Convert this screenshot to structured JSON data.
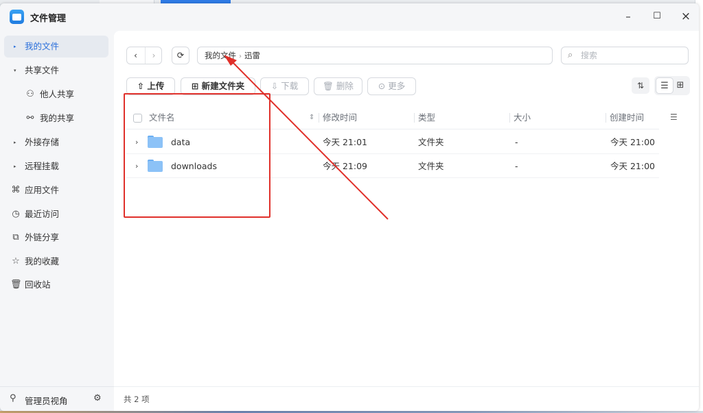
{
  "app": {
    "title": "文件管理",
    "window_controls": {
      "minimize": "–",
      "maximize": "☐",
      "close": "×"
    }
  },
  "sidebar": {
    "items": [
      {
        "label": "我的文件",
        "icon": "caret-right-icon",
        "glyph": "▸",
        "active": true
      },
      {
        "label": "共享文件",
        "icon": "caret-down-icon",
        "glyph": "▾"
      },
      {
        "label": "他人共享",
        "icon": "user-share-icon",
        "glyph": "⚇"
      },
      {
        "label": "我的共享",
        "icon": "share-icon",
        "glyph": "⚯"
      },
      {
        "label": "外接存储",
        "icon": "caret-right-icon",
        "glyph": "▸"
      },
      {
        "label": "远程挂载",
        "icon": "caret-right-icon",
        "glyph": "▸"
      },
      {
        "label": "应用文件",
        "icon": "apps-grid-icon",
        "glyph": "⌘"
      },
      {
        "label": "最近访问",
        "icon": "clock-icon",
        "glyph": "◷"
      },
      {
        "label": "外链分享",
        "icon": "external-link-icon",
        "glyph": "⧉"
      },
      {
        "label": "我的收藏",
        "icon": "star-icon",
        "glyph": "☆"
      },
      {
        "label": "回收站",
        "icon": "trash-icon",
        "glyph": "🗑"
      }
    ],
    "footer": {
      "label": "管理员视角",
      "icon_glyph": "⚲",
      "gear_glyph": "⚙"
    }
  },
  "toolbar": {
    "back_glyph": "‹",
    "forward_glyph": "›",
    "refresh_glyph": "⟳",
    "breadcrumb": [
      "我的文件",
      "迅雷"
    ],
    "breadcrumb_sep": "›",
    "search_placeholder": "搜索",
    "search_glyph": "⌕",
    "upload": "上传",
    "upload_glyph": "⇧",
    "new_folder": "新建文件夹",
    "new_folder_glyph": "⊞",
    "download": "下载",
    "download_glyph": "⇩",
    "delete": "删除",
    "delete_glyph": "🗑",
    "more": "更多",
    "more_glyph": "⊙",
    "sort_glyph": "⇅",
    "list_view_glyph": "☰",
    "grid_view_glyph": "⊞"
  },
  "table": {
    "columns": {
      "name": "文件名",
      "modified": "修改时间",
      "type": "类型",
      "size": "大小",
      "created": "创建时间",
      "sort_glyph": "⇕",
      "settings_glyph": "☰"
    },
    "rows": [
      {
        "name": "data",
        "modified": "今天 21:01",
        "type": "文件夹",
        "size": "-",
        "created": "今天 21:00",
        "chevron": "›"
      },
      {
        "name": "downloads",
        "modified": "今天 21:09",
        "type": "文件夹",
        "size": "-",
        "created": "今天 21:00",
        "chevron": "›"
      }
    ]
  },
  "status": {
    "count": "共 2 项"
  },
  "annotation": {
    "color": "#e0302a"
  }
}
